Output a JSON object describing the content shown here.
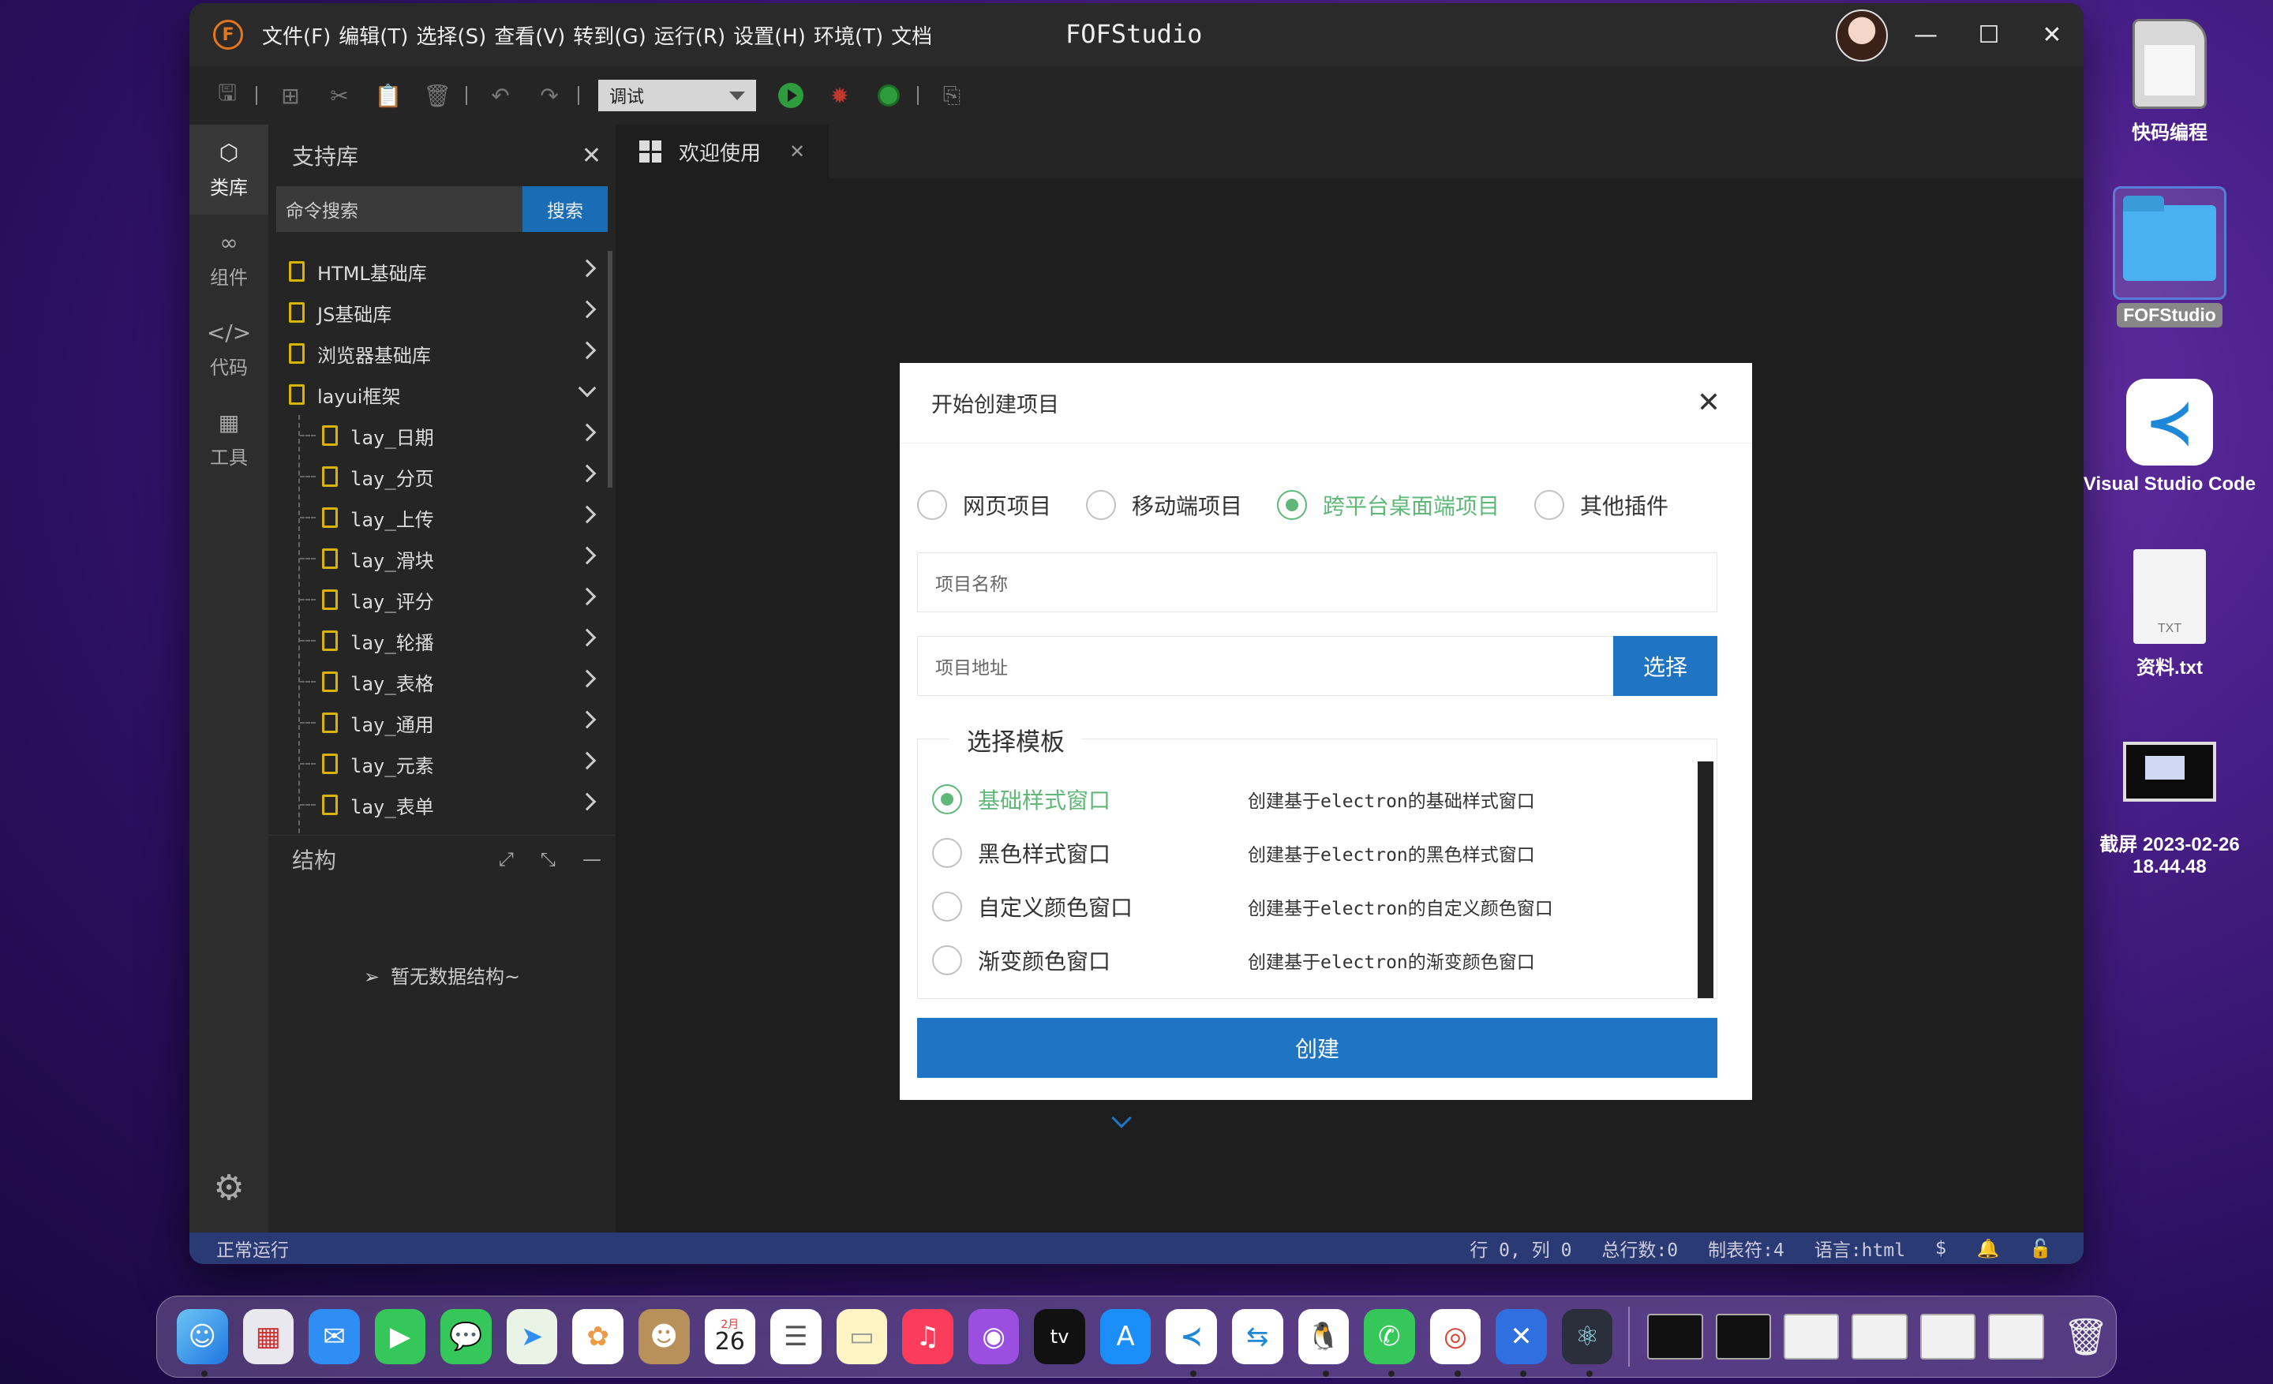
{
  "app": {
    "logo_letter": "F",
    "title": "FOFStudio",
    "menu": [
      "文件(F)",
      "编辑(T)",
      "选择(S)",
      "查看(V)",
      "转到(G)",
      "运行(R)",
      "设置(H)",
      "环境(T)",
      "文档"
    ]
  },
  "toolbar": {
    "mode_select": "调试"
  },
  "activity": {
    "items": [
      {
        "label": "类库",
        "icon": "cube-icon"
      },
      {
        "label": "组件",
        "icon": "link-icon"
      },
      {
        "label": "代码",
        "icon": "code-icon"
      },
      {
        "label": "工具",
        "icon": "tools-icon"
      }
    ]
  },
  "sidebar": {
    "title": "支持库",
    "search_placeholder": "命令搜索",
    "search_button": "搜索",
    "tree": [
      {
        "label": "HTML基础库",
        "level": 0,
        "expanded": false
      },
      {
        "label": "JS基础库",
        "level": 0,
        "expanded": false
      },
      {
        "label": "浏览器基础库",
        "level": 0,
        "expanded": false
      },
      {
        "label": "layui框架",
        "level": 0,
        "expanded": true
      },
      {
        "label": "lay_日期",
        "level": 1,
        "expanded": false
      },
      {
        "label": "lay_分页",
        "level": 1,
        "expanded": false
      },
      {
        "label": "lay_上传",
        "level": 1,
        "expanded": false
      },
      {
        "label": "lay_滑块",
        "level": 1,
        "expanded": false
      },
      {
        "label": "lay_评分",
        "level": 1,
        "expanded": false
      },
      {
        "label": "lay_轮播",
        "level": 1,
        "expanded": false
      },
      {
        "label": "lay_表格",
        "level": 1,
        "expanded": false
      },
      {
        "label": "lay_通用",
        "level": 1,
        "expanded": false
      },
      {
        "label": "lay_元素",
        "level": 1,
        "expanded": false
      },
      {
        "label": "lay_表单",
        "level": 1,
        "expanded": false
      }
    ],
    "structure_title": "结构",
    "structure_empty": "暂无数据结构~"
  },
  "editor": {
    "tab_label": "欢迎使用"
  },
  "modal": {
    "title": "开始创建项目",
    "project_types": [
      {
        "label": "网页项目",
        "selected": false
      },
      {
        "label": "移动端项目",
        "selected": false
      },
      {
        "label": "跨平台桌面端项目",
        "selected": true
      },
      {
        "label": "其他插件",
        "selected": false
      }
    ],
    "name_placeholder": "项目名称",
    "path_placeholder": "项目地址",
    "choose_button": "选择",
    "template_legend": "选择模板",
    "templates": [
      {
        "label": "基础样式窗口",
        "desc": "创建基于electron的基础样式窗口",
        "selected": true
      },
      {
        "label": "黑色样式窗口",
        "desc": "创建基于electron的黑色样式窗口",
        "selected": false
      },
      {
        "label": "自定义颜色窗口",
        "desc": "创建基于electron的自定义颜色窗口",
        "selected": false
      },
      {
        "label": "渐变颜色窗口",
        "desc": "创建基于electron的渐变颜色窗口",
        "selected": false
      }
    ],
    "create_button": "创建"
  },
  "statusbar": {
    "left": "正常运行",
    "position": "行 0, 列 0",
    "total_lines": "总行数:0",
    "tab_size": "制表符:4",
    "language": "语言:html"
  },
  "desktop": {
    "icons": [
      "快码编程",
      "FOFStudio",
      "Visual Studio Code",
      "资料.txt",
      "截屏 2023-02-26",
      "18.44.48"
    ],
    "txt_badge": "TXT"
  },
  "dock": {
    "calendar_month": "2月",
    "calendar_day": "26",
    "tv_label": "tv"
  },
  "colors": {
    "accent_blue": "#1f74c4",
    "radio_green": "#5fb878",
    "statusbar": "#2a3a74"
  }
}
